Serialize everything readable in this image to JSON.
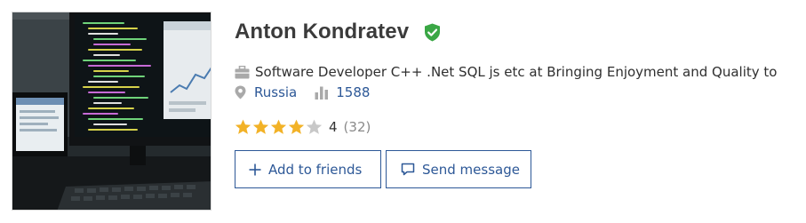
{
  "profile": {
    "name": "Anton Kondratev",
    "verified_icon": "verified-shield-icon",
    "photo_icon": "profile-photo",
    "occupation": "Software Developer C++ .Net SQL js etc at Bringing Enjoyment and Quality to",
    "occupation_icon": "briefcase-icon",
    "location": "Russia",
    "location_icon": "map-pin-icon",
    "stat_value": "1588",
    "stat_icon": "bar-chart-icon",
    "rating": {
      "value": "4",
      "count": "(32)",
      "stars_filled": 4,
      "stars_total": 5
    }
  },
  "actions": {
    "add_friends_label": "Add to friends",
    "send_message_label": "Send message"
  },
  "colors": {
    "text": "#3b3b3b",
    "link": "#2d5897",
    "star_filled": "#f2b227",
    "star_empty": "#c8c8c8",
    "verified": "#3aa745",
    "icon_gray": "#a9a9a9"
  }
}
